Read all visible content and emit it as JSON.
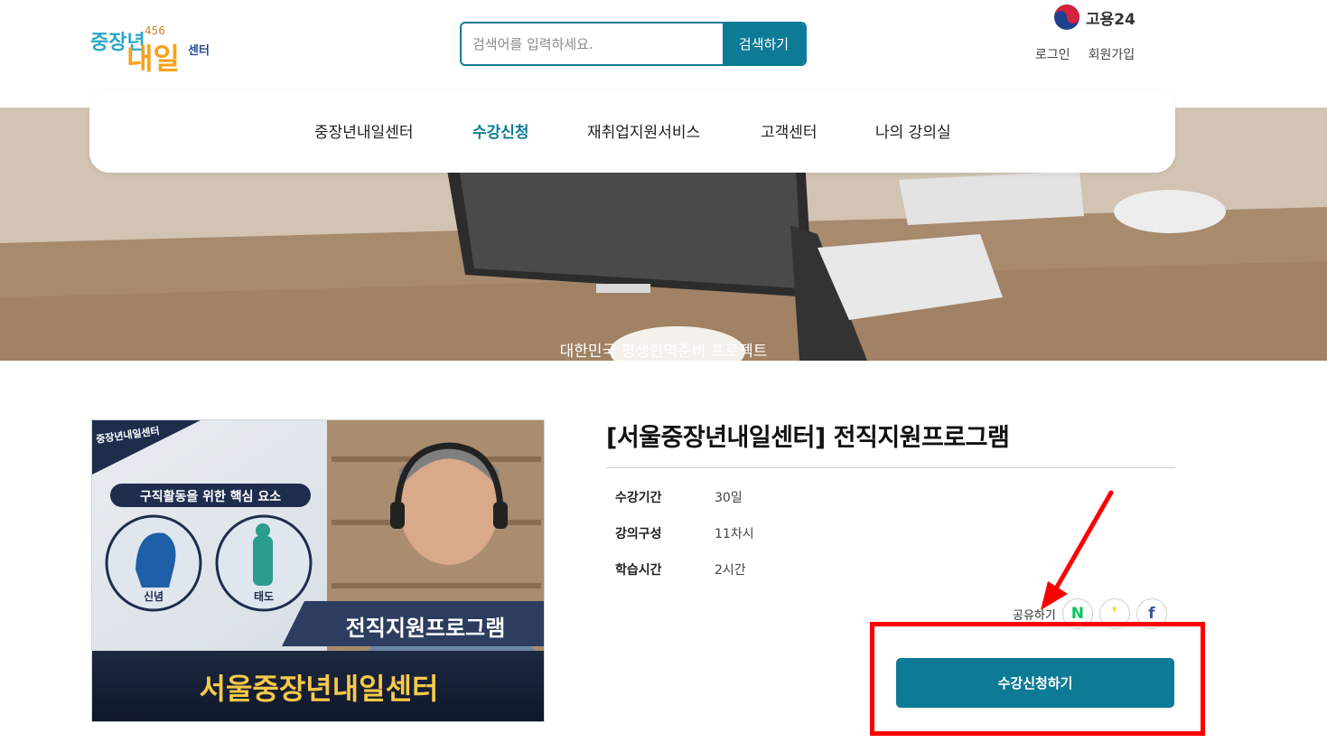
{
  "header": {
    "logo_main": "중장년",
    "logo_big": "내일",
    "logo_small": "센터",
    "logo_badge": "456",
    "search_placeholder": "검색어를 입력하세요.",
    "search_button": "검색하기",
    "brand": "고용24",
    "login": "로그인",
    "signup": "회원가입"
  },
  "nav": {
    "items": [
      {
        "label": "중장년내일센터"
      },
      {
        "label": "수강신청"
      },
      {
        "label": "재취업지원서비스"
      },
      {
        "label": "고객센터"
      },
      {
        "label": "나의 강의실"
      }
    ],
    "active_index": 1
  },
  "hero": {
    "caption": "대한민국 평생현역준비 프로젝트"
  },
  "thumbnail": {
    "logo_text": "중장년내일센터",
    "banner": "구직활동을 위한 핵심 요소",
    "circle1_label": "신념",
    "circle2_label": "태도",
    "subtitle": "전직지원프로그램",
    "center_name": "서울중장년내일센터"
  },
  "course": {
    "title": "[서울중장년내일센터] 전직지원프로그램",
    "info": [
      {
        "key": "수강기간",
        "value": "30일"
      },
      {
        "key": "강의구성",
        "value": "11차시"
      },
      {
        "key": "학습시간",
        "value": "2시간"
      }
    ]
  },
  "share": {
    "label": "공유하기",
    "naver": "N",
    "kakao": "❜",
    "facebook": "f"
  },
  "apply_button": "수강신청하기",
  "colors": {
    "accent": "#0d7b96",
    "highlight": "#ff0000",
    "naver": "#03c75a",
    "kakao": "#f7d51a",
    "facebook": "#3b5998"
  }
}
